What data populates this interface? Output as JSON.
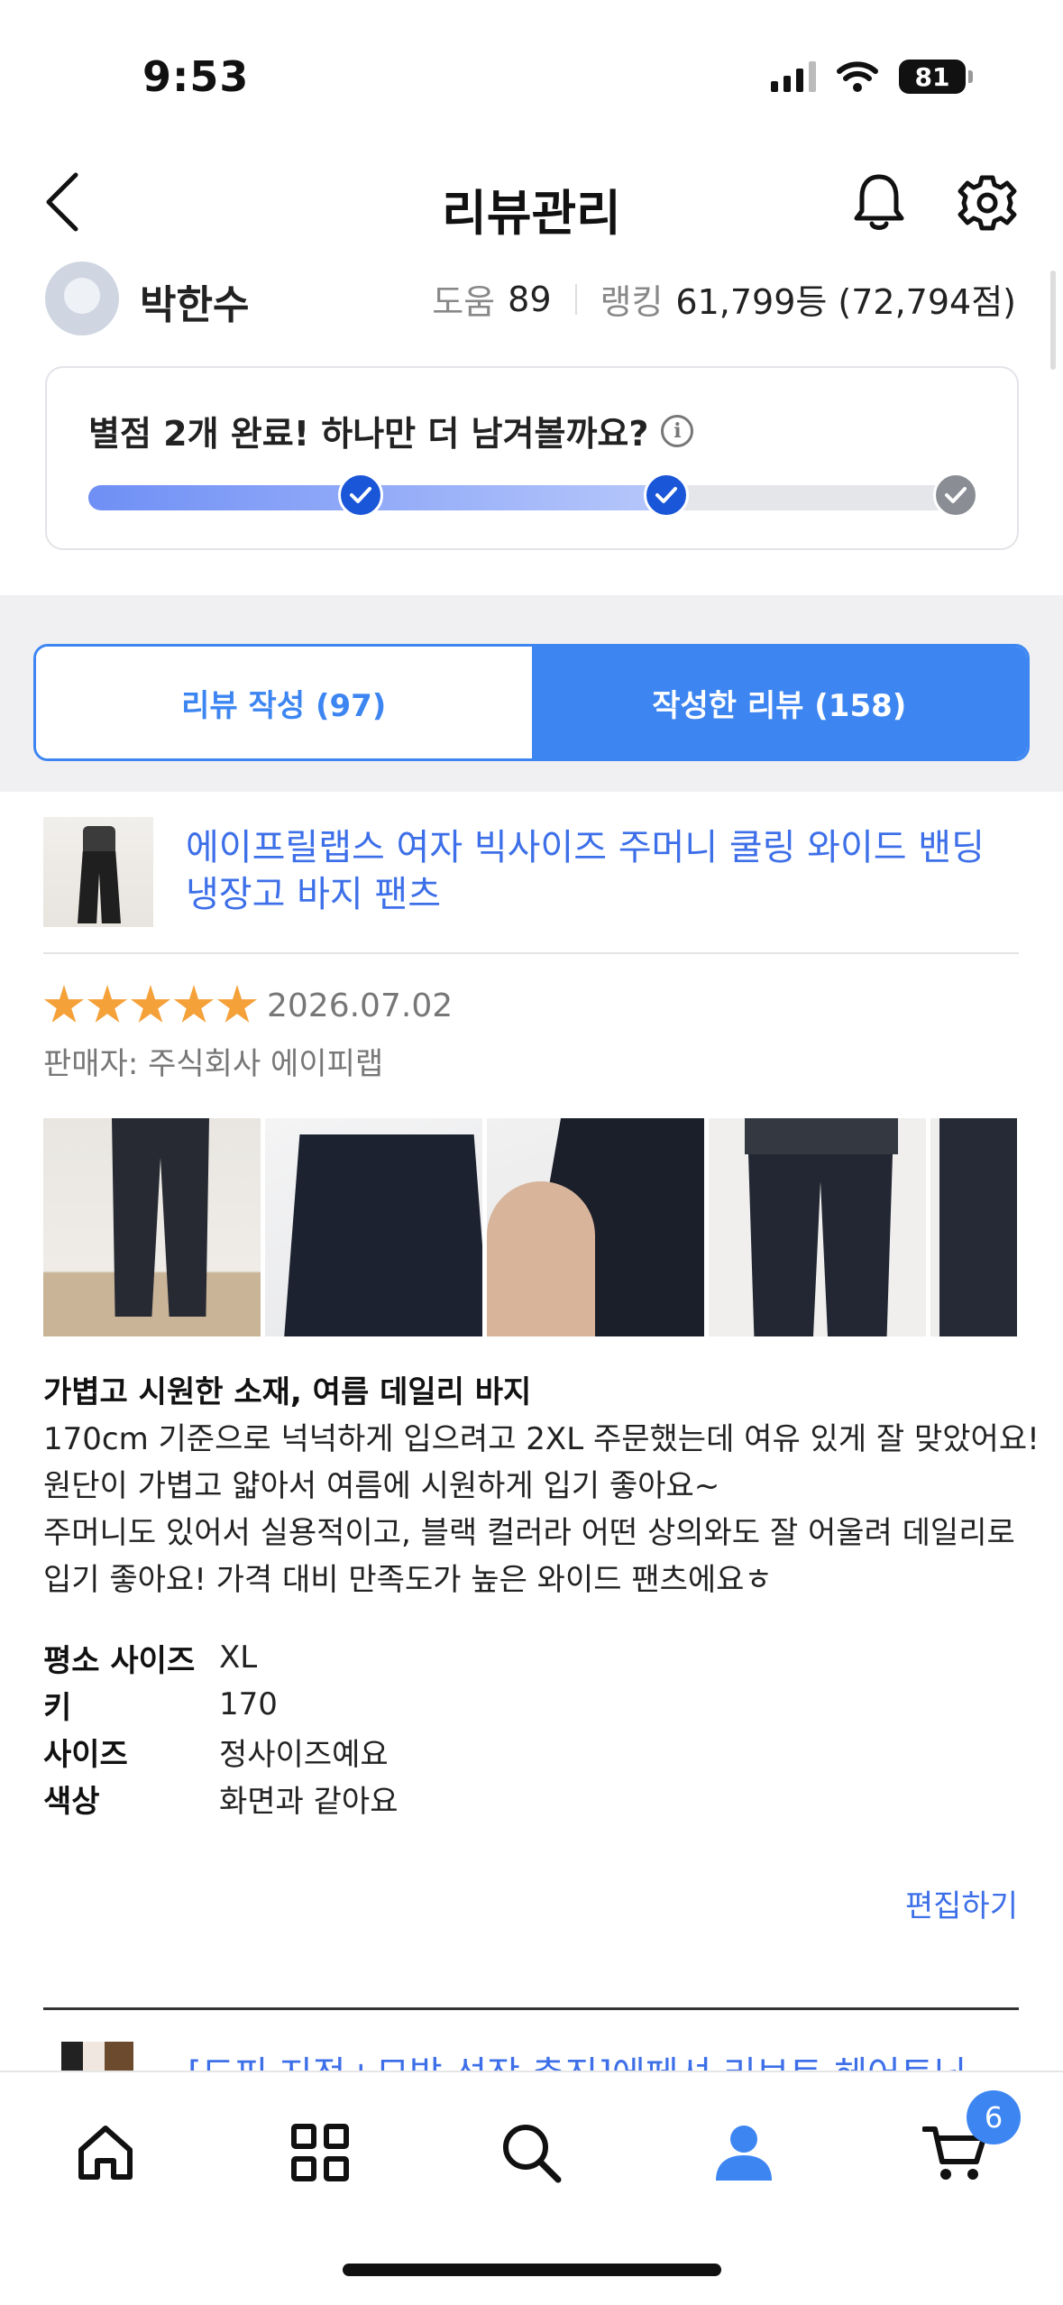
{
  "status_bar": {
    "time": "9:53",
    "battery": "81"
  },
  "header": {
    "title": "리뷰관리"
  },
  "profile": {
    "name": "박한수",
    "help_label": "도움",
    "help_count": "89",
    "ranking_label": "랭킹",
    "ranking_value": "61,799등 (72,794점)"
  },
  "star_progress": {
    "message": "별점 2개 완료! 하나만 더 남겨볼까요?",
    "completed": 2,
    "total": 3
  },
  "tabs": [
    {
      "label": "리뷰 작성 (97)",
      "active": false
    },
    {
      "label": "작성한 리뷰 (158)",
      "active": true
    }
  ],
  "review": {
    "product_title": "에이프릴랩스 여자 빅사이즈 주머니 쿨링 와이드 밴딩 냉장고 바지 팬츠",
    "rating": 5,
    "date": "2026.07.02",
    "seller": "판매자: 주식회사 에이피랩",
    "headline": "가볍고 시원한 소재, 여름 데일리 바지",
    "body_lines": [
      "170cm 기준으로 넉넉하게 입으려고 2XL 주문했는데 여유 있게 잘 맞았어요!",
      "원단이 가볍고 얇아서 여름에 시원하게 입기 좋아요~",
      "주머니도 있어서 실용적이고, 블랙 컬러라 어떤 상의와도 잘 어울려 데일리로",
      "입기 좋아요! 가격 대비 만족도가 높은 와이드 팬츠에요ㅎ"
    ],
    "attributes": [
      {
        "key": "평소 사이즈",
        "value": "XL"
      },
      {
        "key": "키",
        "value": "170"
      },
      {
        "key": "사이즈",
        "value": "정사이즈예요"
      },
      {
        "key": "색상",
        "value": "화면과 같아요"
      }
    ],
    "edit_label": "편집하기"
  },
  "next_item": {
    "title": "[드피 지정+모발 성장 촉진]에페셔 리브트 헤어토닉"
  },
  "bottom_nav": {
    "items": [
      "home-icon",
      "grid-icon",
      "search-icon",
      "profile-icon",
      "cart-icon"
    ],
    "cart_badge": "6"
  },
  "colors": {
    "accent": "#3d86f2",
    "link": "#3d6fe8",
    "star": "#f5a13a",
    "step_done": "#1a56d8"
  }
}
